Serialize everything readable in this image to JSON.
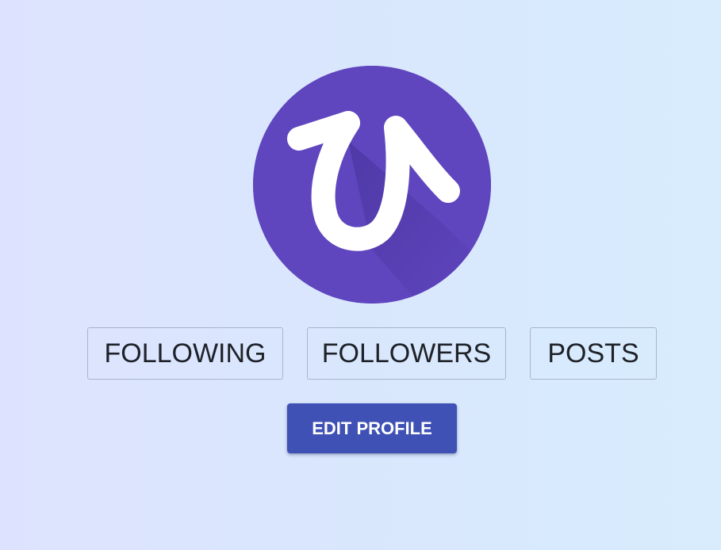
{
  "profile": {
    "avatar_icon": "hiragana-hi-logo-icon",
    "avatar_color": "#5f45be",
    "avatar_glyph_color": "#ffffff"
  },
  "stats": {
    "following_label": "FOLLOWING",
    "followers_label": "FOLLOWERS",
    "posts_label": "POSTS"
  },
  "actions": {
    "edit_profile_label": "EDIT PROFILE",
    "edit_profile_color": "#3f51b5"
  }
}
